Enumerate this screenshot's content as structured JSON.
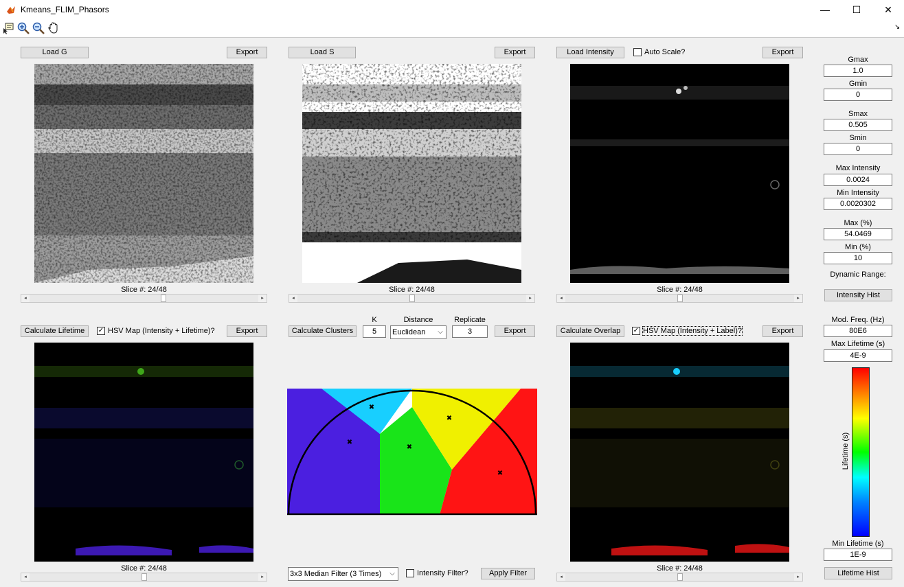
{
  "window": {
    "title": "Kmeans_FLIM_Phasors",
    "min": "—",
    "max": "☐",
    "close": "✕"
  },
  "panels": {
    "g": {
      "load": "Load G",
      "export": "Export",
      "slice": "Slice #: 24/48"
    },
    "s": {
      "load": "Load S",
      "export": "Export",
      "slice": "Slice #: 24/48"
    },
    "intensity": {
      "load": "Load Intensity",
      "auto_scale": "Auto Scale?",
      "export": "Export",
      "slice": "Slice #: 24/48"
    },
    "lifetime": {
      "calc": "Calculate Lifetime",
      "hsv": "HSV Map (Intensity + Lifetime)?",
      "export": "Export",
      "slice": "Slice #: 24/48"
    },
    "clusters": {
      "calc": "Calculate Clusters",
      "k_label": "K",
      "k_value": "5",
      "distance_label": "Distance",
      "distance_value": "Euclidean",
      "replicate_label": "Replicate",
      "replicate_value": "3",
      "export": "Export",
      "filter_value": "3x3 Median Filter (3 Times)",
      "intensity_filter": "Intensity Filter?",
      "apply_filter": "Apply Filter"
    },
    "overlap": {
      "calc": "Calculate Overlap",
      "hsv": "HSV Map (Intensity + Label)?",
      "export": "Export",
      "slice": "Slice #: 24/48"
    }
  },
  "side": {
    "gmax_label": "Gmax",
    "gmax": "1.0",
    "gmin_label": "Gmin",
    "gmin": "0",
    "smax_label": "Smax",
    "smax": "0.505",
    "smin_label": "Smin",
    "smin": "0",
    "max_int_label": "Max Intensity",
    "max_int": "0.0024",
    "min_int_label": "Min Intensity",
    "min_int": "0.0020302",
    "max_pct_label": "Max (%)",
    "max_pct": "54.0469",
    "min_pct_label": "Min (%)",
    "min_pct": "10",
    "dyn_range": "Dynamic Range:",
    "int_hist": "Intensity Hist",
    "mod_freq_label": "Mod. Freq. (Hz)",
    "mod_freq": "80E6",
    "max_life_label": "Max Lifetime (s)",
    "max_life": "4E-9",
    "colorbar_label": "Lifetime (s)",
    "min_life_label": "Min Lifetime (s)",
    "min_life": "1E-9",
    "life_hist": "Lifetime Hist"
  },
  "colors": {
    "cluster1": "#4b1fe0",
    "cluster2": "#18cfff",
    "cluster3": "#19e419",
    "cluster4": "#f0f000",
    "cluster5": "#ff1414"
  }
}
